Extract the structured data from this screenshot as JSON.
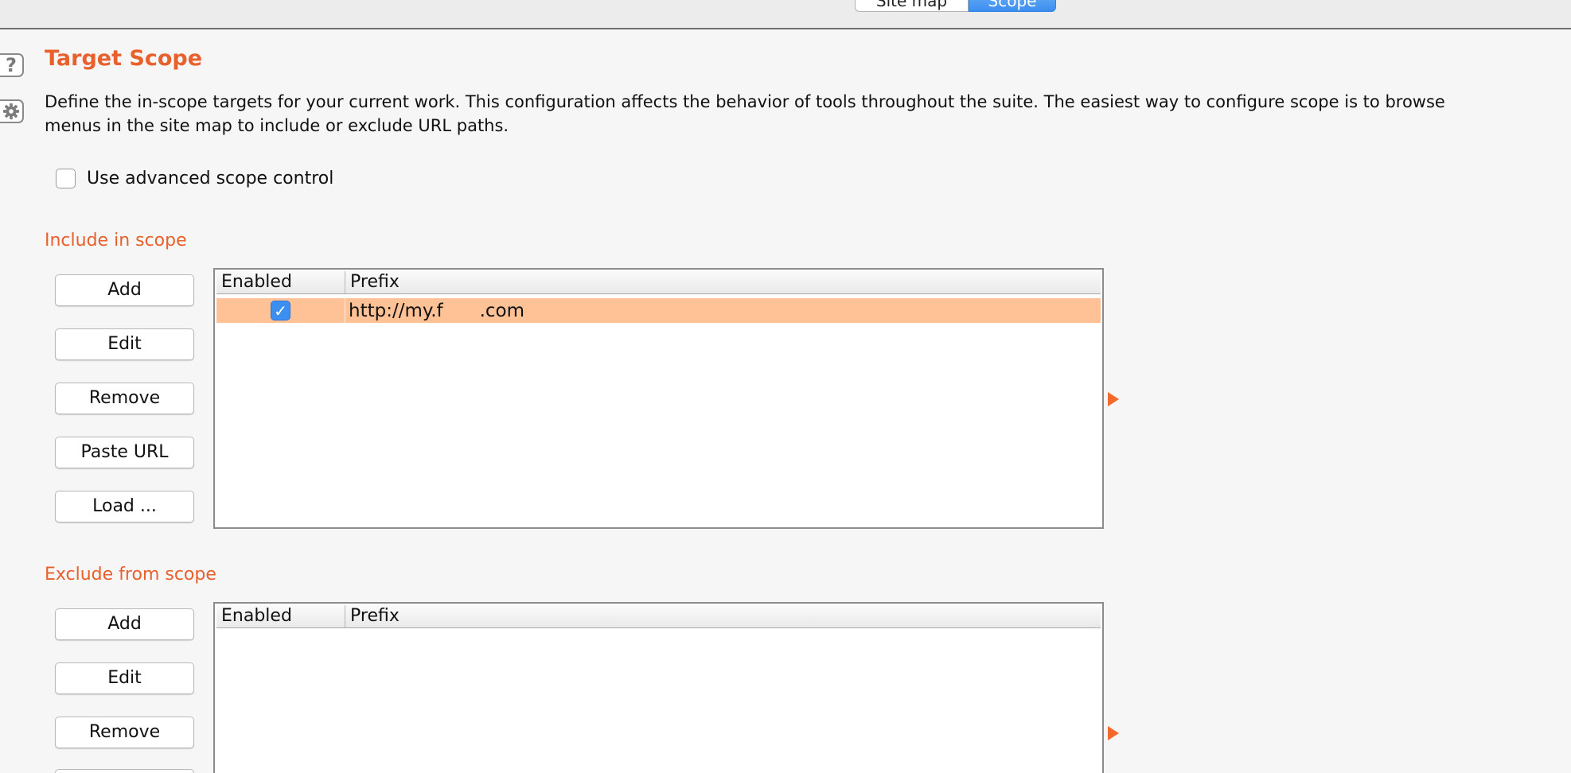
{
  "tabs": [
    {
      "label": "Site map",
      "active": false
    },
    {
      "label": "Scope",
      "active": true
    }
  ],
  "side_icons": {
    "help": "?",
    "settings": "gear-icon"
  },
  "page": {
    "title": "Target Scope",
    "description_line1": "Define the in-scope targets for your current work. This configuration affects the behavior of tools throughout the suite. The easiest way to configure scope is to browse",
    "description_line2": "menus in the site map to include or exclude URL paths."
  },
  "advanced": {
    "label": "Use advanced scope control",
    "checked": false
  },
  "include": {
    "label": "Include in scope",
    "buttons": [
      "Add",
      "Edit",
      "Remove",
      "Paste URL",
      "Load ..."
    ],
    "columns": [
      "Enabled",
      "Prefix"
    ],
    "rows": [
      {
        "enabled": true,
        "enabled_glyph": "✓",
        "prefix": "http://my.f   .com"
      }
    ]
  },
  "exclude": {
    "label": "Exclude from scope",
    "buttons": [
      "Add",
      "Edit",
      "Remove"
    ],
    "columns": [
      "Enabled",
      "Prefix"
    ],
    "rows": []
  },
  "colors": {
    "accent": "#e8602c",
    "selected_row": "#ffc195",
    "tab_active": "#3d8ef0",
    "arrow": "#f26a2a"
  }
}
